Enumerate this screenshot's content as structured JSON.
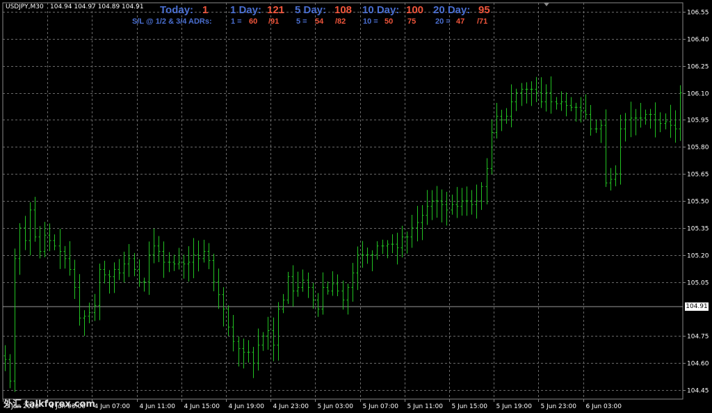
{
  "header": {
    "symbol": "USDJPY,M30",
    "ohlc": "104.94 104.97 104.89 104.91"
  },
  "adr": {
    "today_label": "Today:",
    "today_value": "1",
    "day1_label": "1 Day:",
    "day1_value": "121",
    "day5_label": "5 Day:",
    "day5_value": "108",
    "day10_label": "10 Day:",
    "day10_value": "100",
    "day20_label": "20 Day:",
    "day20_value": "95"
  },
  "sl": {
    "label": "S/L @ 1/2 & 3/4 ADRs:",
    "d1_label": "1 =",
    "d1_half": "60",
    "d1_three_quarter": "/91",
    "d5_label": "5 =",
    "d5_half": "54",
    "d5_three_quarter": "/82",
    "d10_label": "10 =",
    "d10_half": "50",
    "d10_three_quarter": "75",
    "d20_label": "20 =",
    "d20_half": "47",
    "d20_three_quarter": "/71"
  },
  "current_price": "104.91",
  "watermark": "外汇 talkforex.com",
  "colors": {
    "background": "#000000",
    "bars": "#22c322",
    "grid": "#6b6b6b",
    "axis_text": "#ffffff",
    "adr_label": "#4a6fd1",
    "adr_value": "#f0553b"
  },
  "chart_data": {
    "type": "ohlc",
    "symbol": "USDJPY",
    "timeframe": "M30",
    "ylim": [
      104.4,
      106.6
    ],
    "y_ticks": [
      "106.55",
      "106.40",
      "106.25",
      "106.10",
      "105.95",
      "105.80",
      "105.65",
      "105.50",
      "105.35",
      "105.20",
      "105.05",
      "104.91",
      "104.75",
      "104.60",
      "104.45"
    ],
    "x_ticks": [
      "3 Jun 2020",
      "4 Jun 03:00",
      "4 Jun 07:00",
      "4 Jun 11:00",
      "4 Jun 15:00",
      "4 Jun 19:00",
      "4 Jun 23:00",
      "5 Jun 03:00",
      "5 Jun 07:00",
      "5 Jun 11:00",
      "5 Jun 15:00",
      "5 Jun 19:00",
      "5 Jun 23:00",
      "6 Jun 03:00"
    ],
    "current_price": 104.91,
    "closes": [
      104.62,
      104.5,
      105.18,
      105.35,
      105.28,
      105.45,
      105.3,
      105.22,
      105.31,
      105.28,
      105.25,
      105.22,
      105.18,
      105.12,
      105.02,
      104.85,
      104.86,
      104.88,
      104.92,
      105.12,
      105.09,
      105.08,
      105.12,
      105.1,
      105.15,
      105.18,
      105.12,
      105.05,
      105.05,
      105.2,
      105.25,
      105.22,
      105.16,
      105.16,
      105.15,
      105.16,
      105.15,
      105.16,
      105.2,
      105.18,
      105.22,
      105.17,
      105.05,
      104.98,
      104.9,
      104.8,
      104.72,
      104.68,
      104.66,
      104.66,
      104.6,
      104.7,
      104.75,
      104.78,
      104.7,
      104.9,
      104.95,
      105.08,
      105.0,
      105.02,
      105.06,
      105.02,
      104.95,
      104.9,
      105.02,
      105.0,
      105.04,
      105.0,
      104.95,
      105.02,
      105.1,
      105.2,
      105.2,
      105.2,
      105.2,
      105.25,
      105.25,
      105.26,
      105.26,
      105.24,
      105.3,
      105.3,
      105.35,
      105.38,
      105.42,
      105.47,
      105.5,
      105.5,
      105.48,
      105.45,
      105.48,
      105.47,
      105.5,
      105.5,
      105.48,
      105.5,
      105.58,
      105.68,
      105.88,
      105.97,
      105.95,
      105.97,
      106.05,
      106.1,
      106.12,
      106.12,
      106.12,
      106.1,
      106.05,
      106.1,
      106.05,
      106.04,
      106.05,
      106.03,
      106.02,
      106.02,
      106.0,
      105.98,
      105.9,
      105.9,
      105.92,
      105.6,
      105.62,
      105.65,
      105.9,
      105.95,
      105.96,
      105.96,
      105.96,
      105.98,
      105.98,
      105.95,
      105.93,
      105.94,
      105.92,
      105.9,
      106.1
    ]
  }
}
